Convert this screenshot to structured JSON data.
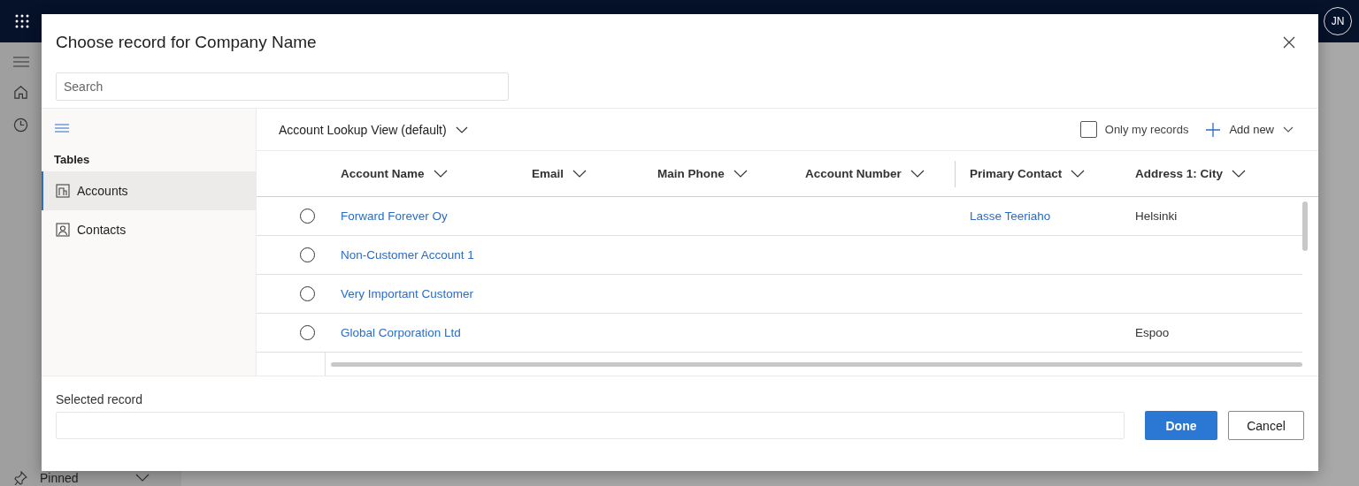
{
  "app": {
    "user_initials": "JN",
    "pinned_label": "Pinned"
  },
  "dialog": {
    "title": "Choose record for Company Name",
    "search": {
      "placeholder": "Search"
    },
    "tables_heading": "Tables",
    "tables": [
      {
        "label": "Accounts",
        "selected": true,
        "kind": "account"
      },
      {
        "label": "Contacts",
        "selected": false,
        "kind": "contact"
      }
    ],
    "view": {
      "label": "Account Lookup View (default)"
    },
    "only_my_records": {
      "label": "Only my records",
      "checked": false
    },
    "add_new": {
      "label": "Add new"
    },
    "columns": [
      "Account Name",
      "Email",
      "Main Phone",
      "Account Number",
      "Primary Contact",
      "Address 1: City"
    ],
    "rows": [
      {
        "selected": false,
        "account_name": "Forward Forever Oy",
        "primary_contact": "Lasse Teeriaho",
        "city": "Helsinki"
      },
      {
        "selected": false,
        "account_name": "Non-Customer Account 1"
      },
      {
        "selected": false,
        "account_name": "Very Important Customer"
      },
      {
        "selected": false,
        "account_name": "Global Corporation Ltd",
        "city": "Espoo"
      }
    ],
    "selected_record": {
      "label": "Selected record"
    },
    "buttons": {
      "done": "Done",
      "cancel": "Cancel"
    }
  }
}
